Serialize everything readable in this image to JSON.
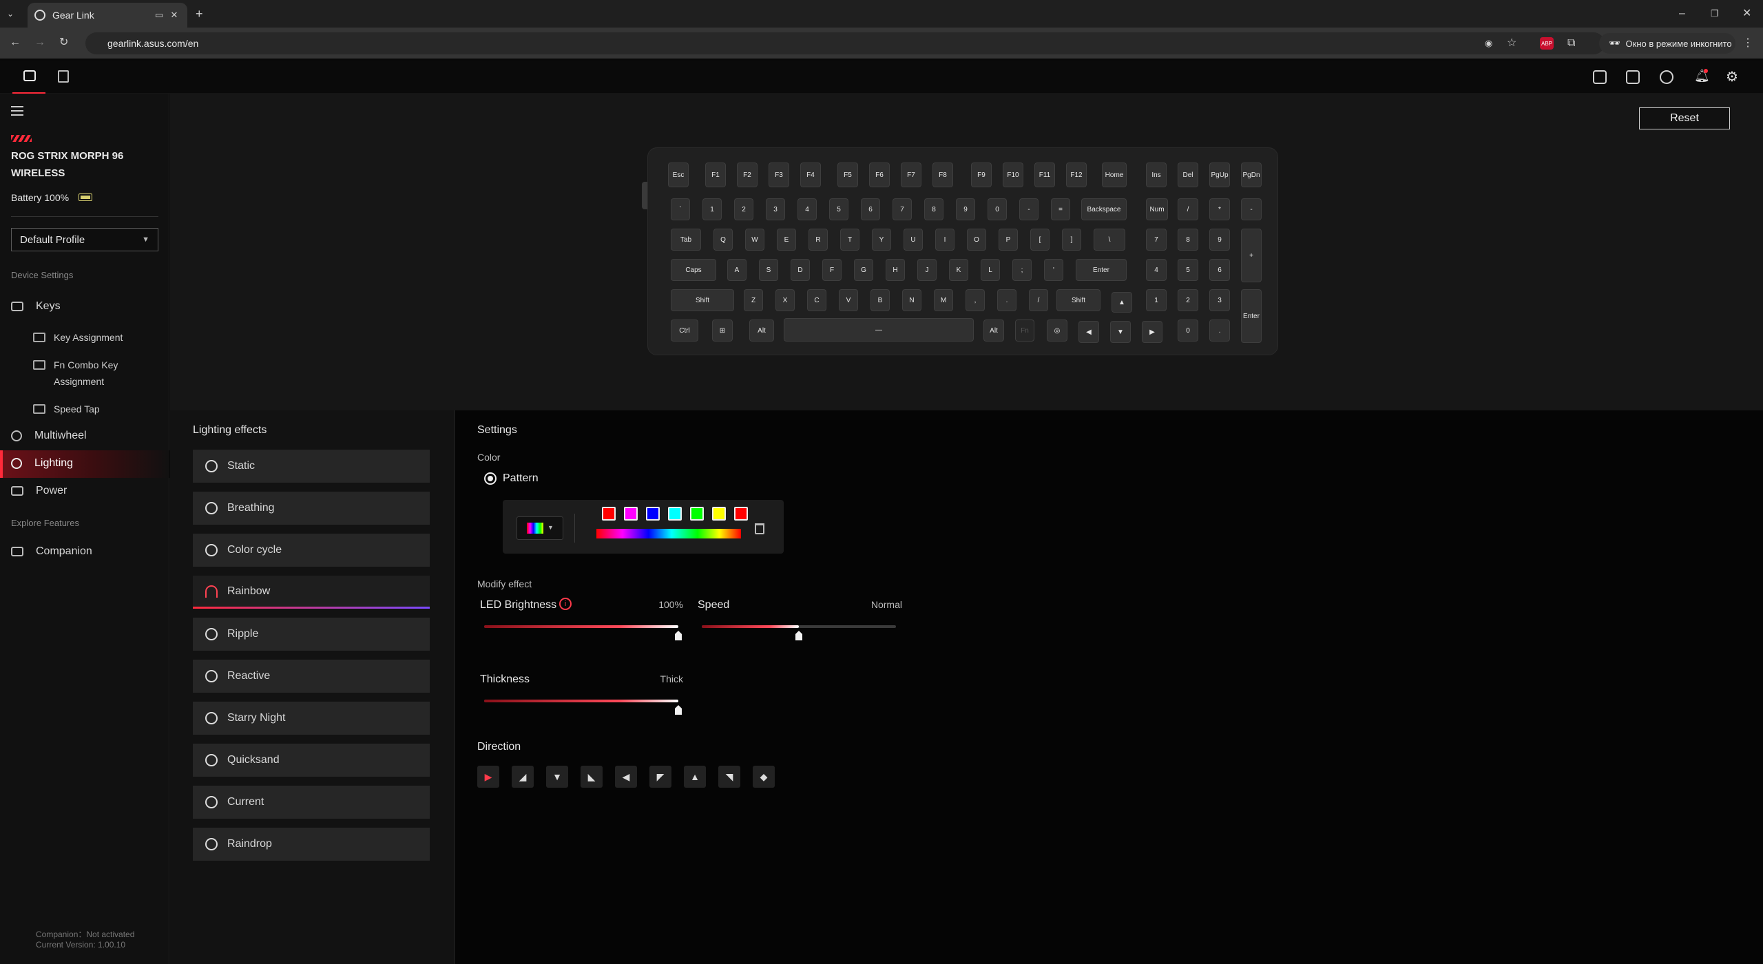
{
  "browser": {
    "tab_title": "Gear Link",
    "url": "gearlink.asus.com/en",
    "incognito_label": "Окно в режиме инкогнито",
    "abp_badge": "ABP"
  },
  "header": {
    "reset_label": "Reset"
  },
  "device": {
    "name": "ROG STRIX MORPH 96 WIRELESS",
    "battery": "Battery 100%",
    "profile": "Default Profile"
  },
  "sidebar": {
    "device_settings": "Device Settings",
    "keys": "Keys",
    "key_assignment": "Key Assignment",
    "fn_combo": "Fn Combo Key Assignment",
    "speed_tap": "Speed Tap",
    "multiwheel": "Multiwheel",
    "lighting": "Lighting",
    "power": "Power",
    "explore": "Explore Features",
    "companion": "Companion",
    "companion_status": "Companion：Not activated",
    "version": "Current Version: 1.00.10"
  },
  "keyboard": {
    "rows": [
      [
        "Esc",
        "F1",
        "F2",
        "F3",
        "F4",
        "F5",
        "F6",
        "F7",
        "F8",
        "F9",
        "F10",
        "F11",
        "F12",
        "Home",
        "Ins",
        "Del",
        "PgUp",
        "PgDn"
      ],
      [
        "`",
        "1",
        "2",
        "3",
        "4",
        "5",
        "6",
        "7",
        "8",
        "9",
        "0",
        "-",
        "=",
        "Backspace",
        "Num",
        "/",
        "*",
        "-"
      ],
      [
        "Tab",
        "Q",
        "W",
        "E",
        "R",
        "T",
        "Y",
        "U",
        "I",
        "O",
        "P",
        "[",
        "]",
        "\\",
        "7",
        "8",
        "9",
        "+"
      ],
      [
        "Caps",
        "A",
        "S",
        "D",
        "F",
        "G",
        "H",
        "J",
        "K",
        "L",
        ";",
        "'",
        "Enter",
        "4",
        "5",
        "6"
      ],
      [
        "Shift",
        "Z",
        "X",
        "C",
        "V",
        "B",
        "N",
        "M",
        ",",
        ".",
        "/",
        "Shift",
        "▲",
        "1",
        "2",
        "3",
        "Enter"
      ],
      [
        "Ctrl",
        "⊞",
        "Alt",
        "—",
        "Alt",
        "Fn",
        "◎",
        "◀",
        "▼",
        "▶",
        "0",
        "."
      ]
    ]
  },
  "effects": {
    "title": "Lighting effects",
    "items": [
      "Static",
      "Breathing",
      "Color cycle",
      "Rainbow",
      "Ripple",
      "Reactive",
      "Starry Night",
      "Quicksand",
      "Current",
      "Raindrop"
    ],
    "active": "Rainbow"
  },
  "settings": {
    "title": "Settings",
    "color_label": "Color",
    "pattern_label": "Pattern",
    "pattern_colors": [
      "#ff0000",
      "#ff00ff",
      "#0000ff",
      "#00ffff",
      "#00ff00",
      "#ffff00",
      "#ff0000"
    ],
    "modify_label": "Modify effect",
    "brightness_label": "LED Brightness",
    "brightness_value": "100%",
    "brightness_level": 1.0,
    "speed_label": "Speed",
    "speed_value": "Normal",
    "speed_level": 0.5,
    "thickness_label": "Thickness",
    "thickness_value": "Thick",
    "thickness_level": 1.0,
    "direction_label": "Direction",
    "directions": [
      "right-icon",
      "down-right-icon",
      "down-icon",
      "down-left-icon",
      "left-icon",
      "up-left-icon",
      "up-icon",
      "up-right-icon",
      "outward-icon"
    ],
    "direction_glyphs": [
      "▶",
      "◢",
      "▼",
      "◣",
      "◀",
      "◤",
      "▲",
      "◥",
      "◆"
    ]
  }
}
